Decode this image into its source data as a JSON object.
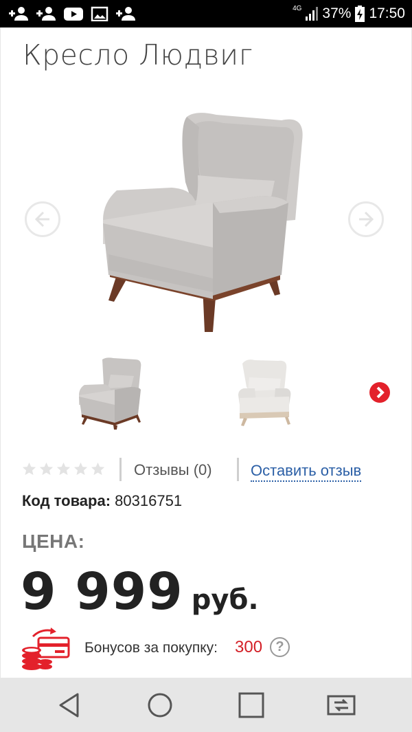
{
  "status_bar": {
    "network": "4G",
    "battery": "37%",
    "time": "17:50",
    "icons": [
      "add-contact-icon",
      "add-contact-icon",
      "youtube-icon",
      "gallery-icon",
      "add-contact-icon",
      "signal-icon",
      "battery-charging-icon"
    ]
  },
  "product": {
    "title": "Кресло Людвиг",
    "sku_label": "Код товара:",
    "sku_value": "80316751",
    "price_label": "ЦЕНА:",
    "price_value": "9 999",
    "currency": "руб.",
    "chair_color": "#c9c6c4",
    "thumb_alt_color": "#e8e6e3",
    "wood_color": "#6b3a26"
  },
  "reviews": {
    "rating": 0,
    "max_rating": 5,
    "count_text": "Отзывы (0)",
    "leave_text": "Оставить отзыв"
  },
  "bonus": {
    "label": "Бонусов за покупку:",
    "value": "300",
    "help": "?"
  },
  "colors": {
    "accent_red": "#e3212b",
    "link_blue": "#2b5fa6",
    "bonus_red": "#d31f26"
  }
}
